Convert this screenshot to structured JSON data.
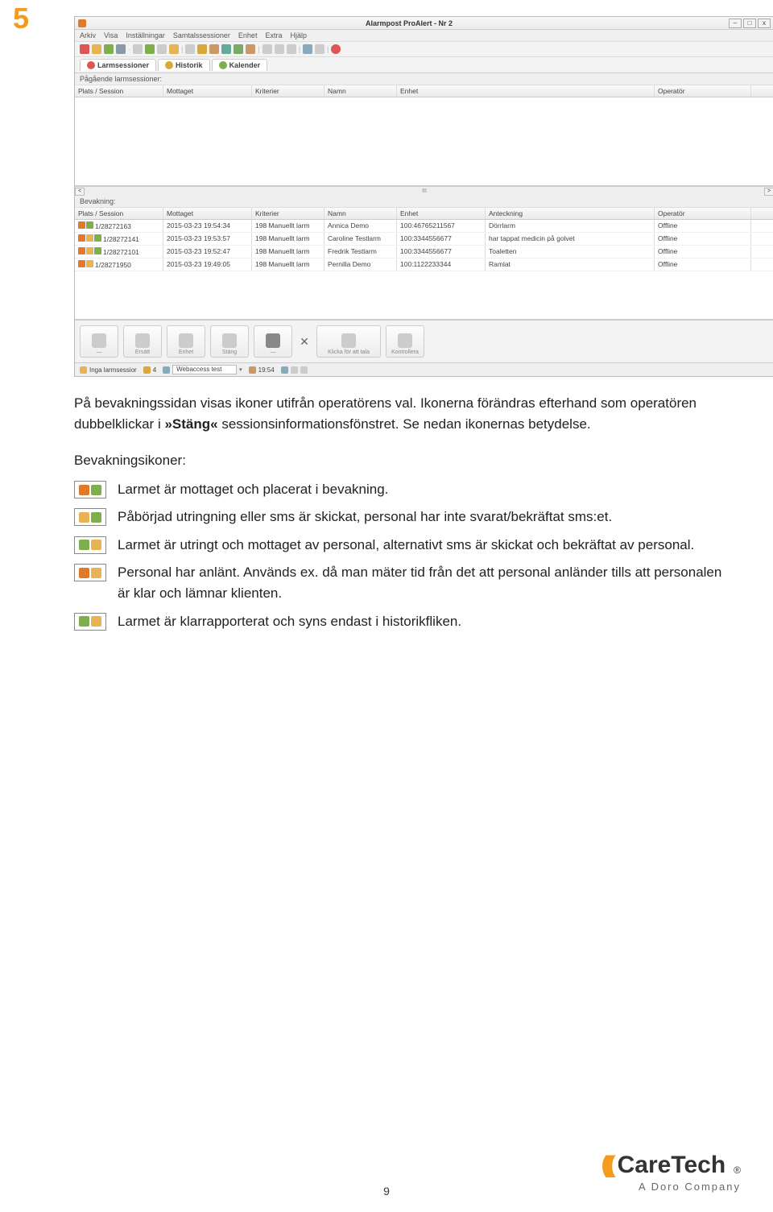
{
  "step_number": "5",
  "window": {
    "title": "Alarmpost ProAlert - Nr 2",
    "menu": [
      "Arkiv",
      "Visa",
      "Inställningar",
      "Samtalssessioner",
      "Enhet",
      "Extra",
      "Hjälp"
    ],
    "tabs": [
      {
        "icon_color": "#d55",
        "label": "Larmsessioner"
      },
      {
        "icon_color": "#d7a93a",
        "label": "Historik"
      },
      {
        "icon_color": "#7fae4d",
        "label": "Kalender"
      }
    ],
    "section1_label": "Pågående larmsessioner:",
    "headers1": [
      "Plats / Session",
      "Mottaget",
      "Kriterier",
      "Namn",
      "Enhet",
      "Operatör"
    ],
    "scrollbar_mid": "III",
    "section2_label": "Bevakning:",
    "headers2": [
      "Plats / Session",
      "Mottaget",
      "Kriterier",
      "Namn",
      "Enhet",
      "Anteckning",
      "Operatör"
    ],
    "rows": [
      {
        "icons": [
          "#e07a2b",
          "#7fae4d"
        ],
        "plats": "1/28272163",
        "mott": "2015-03-23 19:54:34",
        "krit": "198 Manuellt larm",
        "namn": "Annica Demo",
        "enh": "100:46765211567",
        "ant": "Dörrlarm",
        "op": "Offline"
      },
      {
        "icons": [
          "#e07a2b",
          "#e6b455",
          "#7fae4d"
        ],
        "plats": "1/28272141",
        "mott": "2015-03-23 19:53:57",
        "krit": "198 Manuellt larm",
        "namn": "Caroline Testlarm",
        "enh": "100:3344556677",
        "ant": "har tappat medicin på golvet",
        "op": "Offline"
      },
      {
        "icons": [
          "#e07a2b",
          "#e6b455",
          "#7fae4d"
        ],
        "plats": "1/28272101",
        "mott": "2015-03-23 19:52:47",
        "krit": "198 Manuellt larm",
        "namn": "Fredrik Testlarm",
        "enh": "100:3344556677",
        "ant": "Toaletten",
        "op": "Offline"
      },
      {
        "icons": [
          "#e07a2b",
          "#e6b455"
        ],
        "plats": "1/28271950",
        "mott": "2015-03-23 19:49:05",
        "krit": "198 Manuellt larm",
        "namn": "Pernilla Demo",
        "enh": "100:1122233344",
        "ant": "Ramlat",
        "op": "Offline"
      }
    ],
    "action_buttons": [
      "—",
      "Ersätt",
      "Enhet",
      "Stäng",
      "—",
      "Klicka för att tala",
      "Kontrollera"
    ],
    "status": {
      "seg1": "Inga larmsessior",
      "seg2": "4",
      "seg3": "Webaccess test",
      "time": "19:54"
    }
  },
  "paragraph": {
    "pre": "På bevakningssidan visas ikoner utifrån operatörens val. Ikonerna förändras efterhand som operatören dubbelklickar i ",
    "bold": "»Stäng«",
    "post": " sessionsinformationsfönstret. Se nedan ikonernas betydelse."
  },
  "legend_heading": "Bevakningsikoner:",
  "legend": [
    {
      "a": "#e07a2b",
      "b": "#7fae4d",
      "text": "Larmet är mottaget och placerat i bevakning."
    },
    {
      "a": "#e6b455",
      "b": "#7fae4d",
      "text": "Påbörjad utringning eller sms är skickat, personal har inte svarat/bekräftat sms:et."
    },
    {
      "a": "#7fae4d",
      "b": "#e6b455",
      "text": "Larmet är utringt och mottaget av personal, alternativt sms är skickat och bekräftat av personal."
    },
    {
      "a": "#e07a2b",
      "b": "#e6b455",
      "text": "Personal har anlänt. Används ex. då man mäter tid från det att personal anländer tills att personalen är klar och lämnar klienten."
    },
    {
      "a": "#7fae4d",
      "b": "#e6b455",
      "text": "Larmet är klarrapporterat och syns endast i historikfliken."
    }
  ],
  "footer": {
    "brand": "CareTech",
    "sub": "A Doro Company",
    "page": "9"
  }
}
